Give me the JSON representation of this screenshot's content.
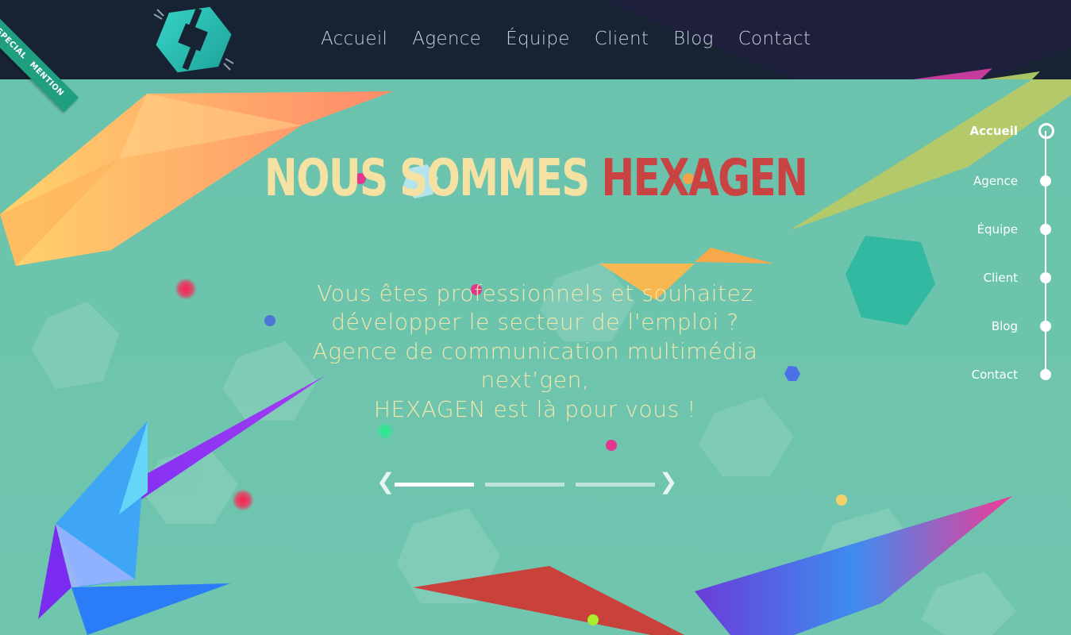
{
  "header": {
    "logo_icon": "hexagen-logo",
    "nav": [
      {
        "label": "Accueil"
      },
      {
        "label": "Agence"
      },
      {
        "label": "Équipe"
      },
      {
        "label": "Client"
      },
      {
        "label": "Blog"
      },
      {
        "label": "Contact"
      }
    ]
  },
  "ribbon": {
    "line1": "SPECIAL",
    "line2": "MENTION"
  },
  "hero": {
    "title_part1": "NOUS SOMMES",
    "title_part2": "HEXAGEN",
    "subtitle_lines": [
      "Vous êtes professionnels et souhaitez",
      "développer le secteur de l'emploi ?",
      "Agence de communication multimédia",
      "next’gen,",
      "HEXAGEN est là pour vous !"
    ],
    "slider": {
      "prev": "❮",
      "next": "❯",
      "count": 3,
      "active_index": 0
    }
  },
  "section_nav": {
    "items": [
      {
        "label": "Accueil",
        "active": true
      },
      {
        "label": "Agence",
        "active": false
      },
      {
        "label": "Équipe",
        "active": false
      },
      {
        "label": "Client",
        "active": false
      },
      {
        "label": "Blog",
        "active": false
      },
      {
        "label": "Contact",
        "active": false
      }
    ]
  },
  "colors": {
    "header_bg": "#172233",
    "hero_bg": "#6cc2ad",
    "title_cream": "#f5e2a3",
    "title_red": "#c94343",
    "subtitle": "#f4e7ac",
    "ribbon": "#1f9e80"
  }
}
